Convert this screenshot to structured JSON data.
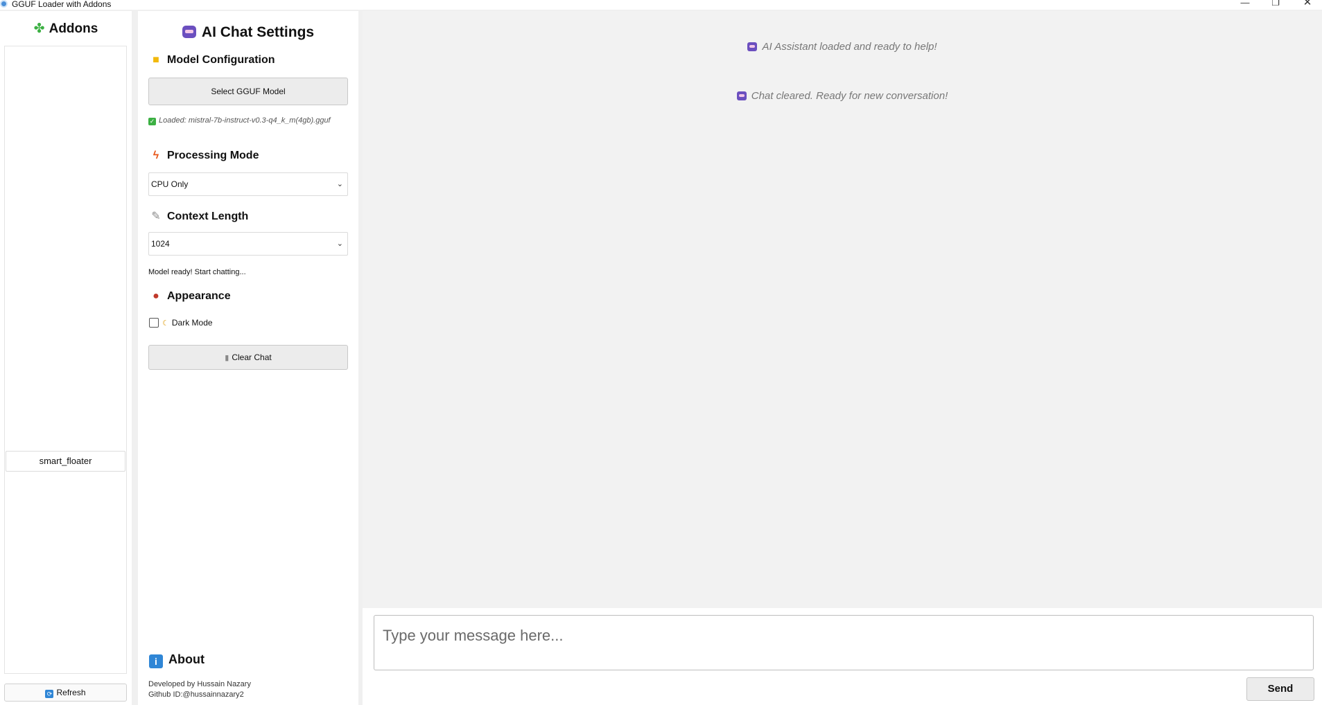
{
  "window": {
    "title": "GGUF Loader with Addons",
    "controls": {
      "minimize": "—",
      "maximize": "❐",
      "close": "✕"
    }
  },
  "addons": {
    "title": "Addons",
    "items": [
      {
        "label": "smart_floater"
      }
    ],
    "refresh_label": "Refresh"
  },
  "settings": {
    "title": "AI Chat Settings",
    "model_section": {
      "heading": "Model Configuration",
      "select_button": "Select GGUF Model",
      "loaded_text": "Loaded: mistral-7b-instruct-v0.3-q4_k_m(4gb).gguf"
    },
    "processing_section": {
      "heading": "Processing Mode",
      "selected": "CPU Only"
    },
    "context_section": {
      "heading": "Context Length",
      "selected": "1024"
    },
    "status_text": "Model ready! Start chatting...",
    "appearance_section": {
      "heading": "Appearance",
      "dark_mode_label": "Dark Mode",
      "dark_mode_checked": false
    },
    "clear_chat_label": "Clear Chat",
    "about_section": {
      "heading": "About",
      "developer": "Developed by Hussain Nazary",
      "github": "Github ID:@hussainnazary2"
    }
  },
  "chat": {
    "messages": [
      {
        "text": "AI Assistant loaded and ready to help!"
      },
      {
        "text": "Chat cleared. Ready for new conversation!"
      }
    ],
    "input_placeholder": "Type your message here...",
    "send_label": "Send"
  },
  "icons": {
    "app": "app-gear-icon",
    "addons": "puzzle-icon",
    "settings": "robot-icon",
    "model": "folder-icon",
    "processing": "lightning-icon",
    "context": "ruler-icon",
    "appearance": "palette-icon",
    "dark_mode": "moon-icon",
    "clear": "trash-icon",
    "about": "info-icon",
    "refresh": "refresh-icon",
    "loaded": "checkmark-icon"
  },
  "colors": {
    "accent_blue": "#2f86d6",
    "success_green": "#3cb043",
    "panel_bg": "#ffffff",
    "chat_bg": "#f2f2f2"
  }
}
